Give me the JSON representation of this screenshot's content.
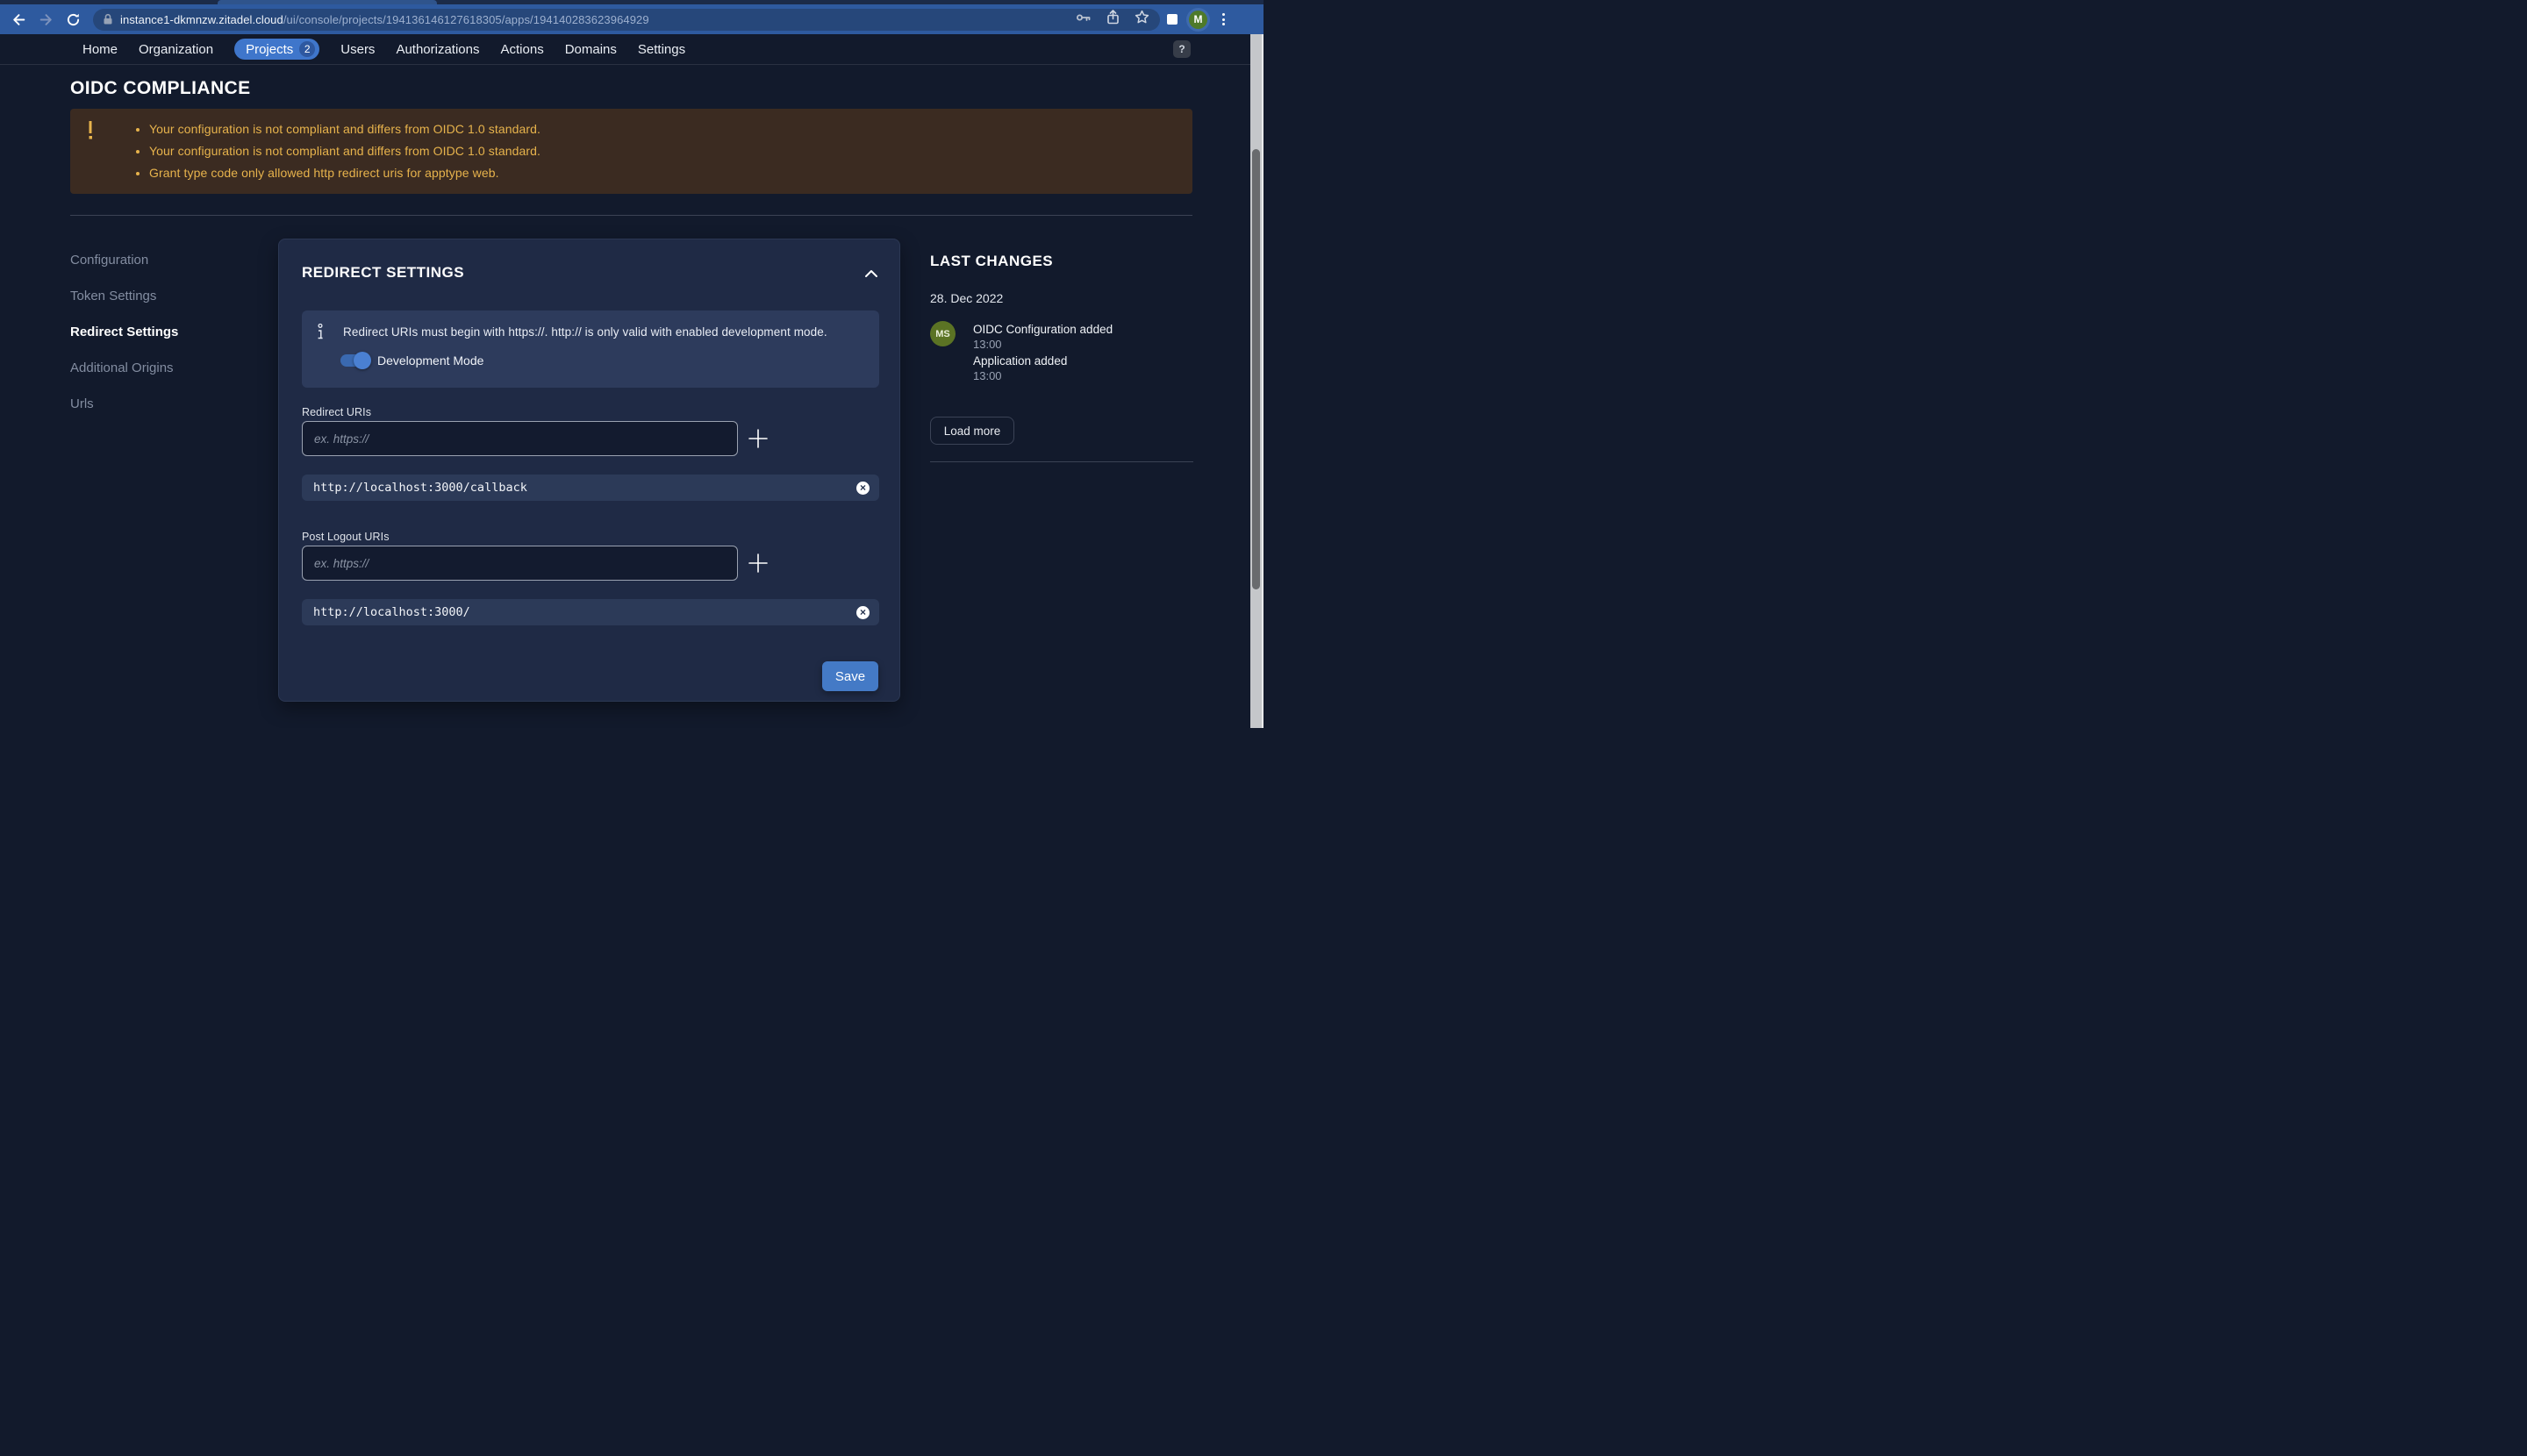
{
  "browser": {
    "url_domain": "instance1-dkmnzw.zitadel.cloud",
    "url_path": "/ui/console/projects/194136146127618305/apps/194140283623964929",
    "avatar_letter": "M"
  },
  "nav": {
    "items": [
      "Home",
      "Organization",
      "Projects",
      "Users",
      "Authorizations",
      "Actions",
      "Domains",
      "Settings"
    ],
    "projects_badge": "2",
    "help_label": "?"
  },
  "page": {
    "title": "OIDC COMPLIANCE",
    "warnings": [
      "Your configuration is not compliant and differs from OIDC 1.0 standard.",
      "Your configuration is not compliant and differs from OIDC 1.0 standard.",
      "Grant type code only allowed http redirect uris for apptype web."
    ]
  },
  "sidebar": {
    "items": [
      "Configuration",
      "Token Settings",
      "Redirect Settings",
      "Additional Origins",
      "Urls"
    ],
    "active": "Redirect Settings"
  },
  "card": {
    "title": "REDIRECT SETTINGS",
    "info_text": "Redirect URIs must begin with https://. http:// is only valid with enabled development mode.",
    "dev_mode_label": "Development Mode",
    "dev_mode_on": true,
    "redirect": {
      "label": "Redirect URIs",
      "placeholder": "ex. https://",
      "chips": [
        "http://localhost:3000/callback"
      ]
    },
    "post_logout": {
      "label": "Post Logout URIs",
      "placeholder": "ex. https://",
      "chips": [
        "http://localhost:3000/"
      ]
    },
    "save_label": "Save"
  },
  "changes": {
    "title": "LAST CHANGES",
    "date": "28. Dec 2022",
    "avatar_initials": "MS",
    "entries": [
      {
        "title": "OIDC Configuration added",
        "time": "13:00"
      },
      {
        "title": "Application added",
        "time": "13:00"
      }
    ],
    "load_more_label": "Load more"
  },
  "icons": [
    "back-icon",
    "forward-icon",
    "reload-icon",
    "lock-icon",
    "key-icon",
    "share-icon",
    "star-icon",
    "side-panel-icon",
    "menu-dots-icon",
    "help-icon",
    "warning-icon",
    "info-icon",
    "chevron-up-icon",
    "plus-icon",
    "remove-icon"
  ],
  "colors": {
    "accent_blue": "#447ac6",
    "browser_theme": "#2e5a9f",
    "warning_text": "#e7b34c",
    "warning_bg": "#3b2b21",
    "avatar_green": "#5b7324",
    "page_bg": "#121a2c",
    "card_bg": "#1f2a45"
  }
}
